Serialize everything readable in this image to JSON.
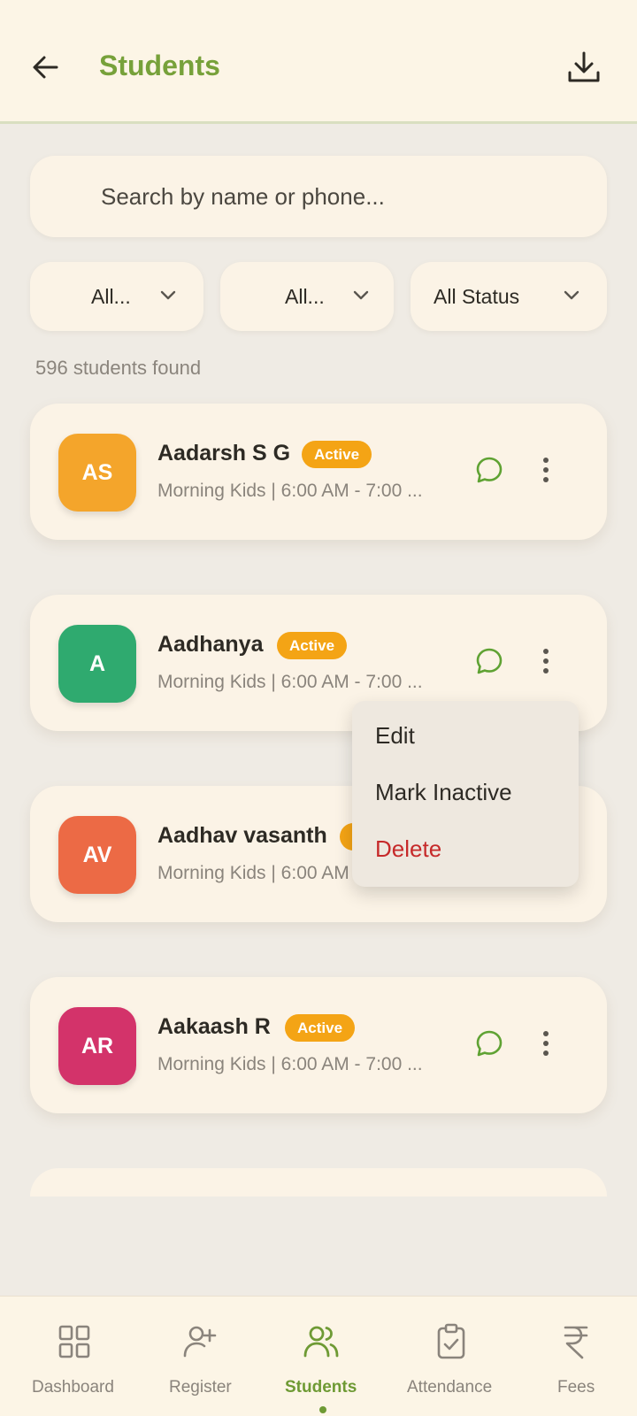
{
  "header": {
    "title": "Students",
    "back_icon": "arrow-left-icon",
    "download_icon": "download-icon"
  },
  "search": {
    "placeholder": "Search by name or phone..."
  },
  "filters": [
    {
      "label": "All...",
      "icon": "chevron-down-icon"
    },
    {
      "label": "All...",
      "icon": "chevron-down-icon"
    },
    {
      "label": "All Status",
      "icon": "chevron-down-icon"
    }
  ],
  "results_count": "596 students found",
  "students": [
    {
      "initials": "AS",
      "name": "Aadarsh S G",
      "status": "Active",
      "batch": "Morning Kids | 6:00 AM - 7:00 ...",
      "avatar_color": "#f4a52b"
    },
    {
      "initials": "A",
      "name": "Aadhanya",
      "status": "Active",
      "batch": "Morning Kids | 6:00 AM - 7:00 ...",
      "avatar_color": "#2faa6f"
    },
    {
      "initials": "AV",
      "name": "Aadhav vasanth",
      "status": "Active",
      "batch": "Morning Kids | 6:00 AM - 7:00 ...",
      "avatar_color": "#ec6a45"
    },
    {
      "initials": "AR",
      "name": "Aakaash R",
      "status": "Active",
      "batch": "Morning Kids | 6:00 AM - 7:00 ...",
      "avatar_color": "#d3336a"
    }
  ],
  "context_menu": {
    "items": [
      {
        "label": "Edit",
        "color": "#2d2a24"
      },
      {
        "label": "Mark Inactive",
        "color": "#2d2a24"
      },
      {
        "label": "Delete",
        "color": "#c62a2a"
      }
    ]
  },
  "bottom_nav": {
    "items": [
      {
        "label": "Dashboard",
        "icon": "dashboard-icon"
      },
      {
        "label": "Register",
        "icon": "add-user-icon"
      },
      {
        "label": "Students",
        "icon": "users-icon",
        "active": true
      },
      {
        "label": "Attendance",
        "icon": "clipboard-check-icon"
      },
      {
        "label": "Fees",
        "icon": "rupee-icon"
      }
    ]
  },
  "colors": {
    "accent": "#77a13a",
    "badge": "#f4a415",
    "delete": "#c62a2a",
    "background": "#efebe4",
    "card": "#fbf3e6"
  }
}
